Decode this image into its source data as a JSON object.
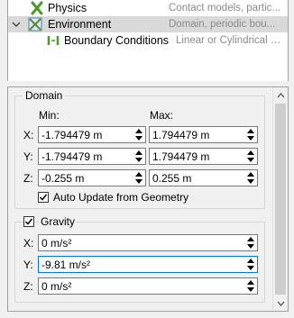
{
  "tree": {
    "items": [
      {
        "name": "Physics",
        "desc": "Contact models, partic...",
        "icon": "physics-icon"
      },
      {
        "name": "Environment",
        "desc": "Domain, periodic bou...",
        "icon": "environment-icon"
      },
      {
        "name": "Boundary Conditions",
        "desc": "Linear or Cylindrical p...",
        "icon": "boundary-conditions-icon"
      }
    ]
  },
  "domain": {
    "title": "Domain",
    "min_label": "Min:",
    "max_label": "Max:",
    "rows": [
      {
        "axis": "X:",
        "min": "-1.794479 m",
        "max": "1.794479 m"
      },
      {
        "axis": "Y:",
        "min": "-1.794479 m",
        "max": "1.794479 m"
      },
      {
        "axis": "Z:",
        "min": "-0.255 m",
        "max": "0.255 m"
      }
    ],
    "auto_update_label": "Auto Update from Geometry",
    "auto_update_checked": true
  },
  "gravity": {
    "label": "Gravity",
    "checked": true,
    "rows": [
      {
        "axis": "X:",
        "value": "0 m/s²"
      },
      {
        "axis": "Y:",
        "value": "-9.81 m/s²"
      },
      {
        "axis": "Z:",
        "value": "0 m/s²"
      }
    ]
  },
  "colors": {
    "selection": "#d9d9d9",
    "focus_border": "#0078d7",
    "desc_text": "#8a8a8a"
  }
}
